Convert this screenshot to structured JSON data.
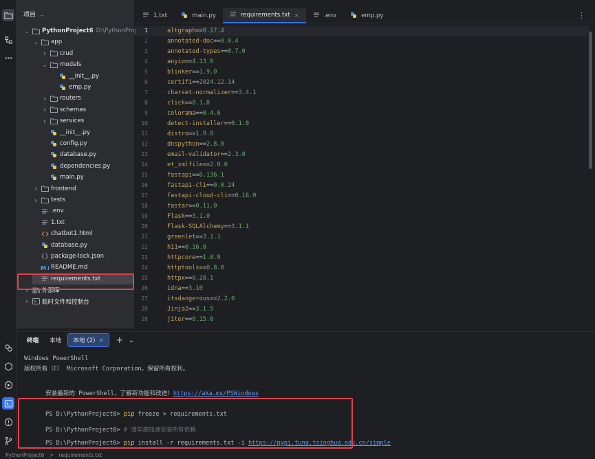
{
  "project": {
    "header": "项目",
    "tree": [
      {
        "label": "PythonProject6",
        "dim": "D:\\PythonProjec",
        "icon": "folder",
        "chev": "open",
        "level": 0,
        "bold": true
      },
      {
        "label": "app",
        "icon": "folder",
        "chev": "open",
        "level": 1
      },
      {
        "label": "crud",
        "icon": "folder",
        "chev": "closed",
        "level": 2
      },
      {
        "label": "models",
        "icon": "folder",
        "chev": "open",
        "level": 2
      },
      {
        "label": "__init__.py",
        "icon": "python",
        "chev": "none",
        "level": 3
      },
      {
        "label": "emp.py",
        "icon": "python",
        "chev": "none",
        "level": 3
      },
      {
        "label": "routers",
        "icon": "folder",
        "chev": "closed",
        "level": 2
      },
      {
        "label": "schemas",
        "icon": "folder",
        "chev": "closed",
        "level": 2
      },
      {
        "label": "services",
        "icon": "folder",
        "chev": "closed",
        "level": 2
      },
      {
        "label": "__init__.py",
        "icon": "python",
        "chev": "none",
        "level": 2
      },
      {
        "label": "config.py",
        "icon": "python",
        "chev": "none",
        "level": 2
      },
      {
        "label": "database.py",
        "icon": "python",
        "chev": "none",
        "level": 2
      },
      {
        "label": "dependencies.py",
        "icon": "python",
        "chev": "none",
        "level": 2
      },
      {
        "label": "main.py",
        "icon": "python",
        "chev": "none",
        "level": 2
      },
      {
        "label": "frontend",
        "icon": "folder",
        "chev": "closed",
        "level": 1
      },
      {
        "label": "tests",
        "icon": "folder",
        "chev": "closed",
        "level": 1
      },
      {
        "label": ".env",
        "icon": "text",
        "chev": "none",
        "level": 1
      },
      {
        "label": "1.txt",
        "icon": "text",
        "chev": "none",
        "level": 1
      },
      {
        "label": "chatbot1.html",
        "icon": "html",
        "chev": "none",
        "level": 1
      },
      {
        "label": "database.py",
        "icon": "python",
        "chev": "none",
        "level": 1
      },
      {
        "label": "package-lock.json",
        "icon": "json",
        "chev": "none",
        "level": 1
      },
      {
        "label": "README.md",
        "icon": "md",
        "chev": "none",
        "level": 1
      },
      {
        "label": "requirements.txt",
        "icon": "text",
        "chev": "none",
        "level": 1,
        "selected": true
      },
      {
        "label": "外部库",
        "icon": "library",
        "chev": "closed",
        "level": 0
      },
      {
        "label": "临时文件和控制台",
        "icon": "scratch",
        "chev": "closed",
        "level": 0
      }
    ]
  },
  "tabs": [
    {
      "label": "1.txt",
      "icon": "text"
    },
    {
      "label": "main.py",
      "icon": "python"
    },
    {
      "label": "requirements.txt",
      "icon": "text",
      "active": true,
      "close": "×"
    },
    {
      "label": ".env",
      "icon": "text"
    },
    {
      "label": "emp.py",
      "icon": "python"
    }
  ],
  "kebab": "⋮",
  "requirements": [
    [
      "altgraph",
      "0.17.4"
    ],
    [
      "annotated-doc",
      "0.0.4"
    ],
    [
      "annotated-types",
      "0.7.0"
    ],
    [
      "anyio",
      "4.13.0"
    ],
    [
      "blinker",
      "1.9.0"
    ],
    [
      "certifi",
      "2024.12.14"
    ],
    [
      "charset-normalizer",
      "3.4.1"
    ],
    [
      "click",
      "8.1.8"
    ],
    [
      "colorama",
      "0.4.6"
    ],
    [
      "detect-installer",
      "0.1.0"
    ],
    [
      "distro",
      "1.9.0"
    ],
    [
      "dnspython",
      "2.8.0"
    ],
    [
      "email-validator",
      "2.3.0"
    ],
    [
      "et_xmlfile",
      "2.0.0"
    ],
    [
      "fastapi",
      "0.136.1"
    ],
    [
      "fastapi-cli",
      "0.0.24"
    ],
    [
      "fastapi-cloud-cli",
      "0.18.0"
    ],
    [
      "fastar",
      "0.11.0"
    ],
    [
      "Flask",
      "3.1.0"
    ],
    [
      "Flask-SQLAlchemy",
      "3.1.1"
    ],
    [
      "greenlet",
      "3.1.1"
    ],
    [
      "h11",
      "0.16.0"
    ],
    [
      "httpcore",
      "1.0.9"
    ],
    [
      "httptools",
      "0.8.0"
    ],
    [
      "httpx",
      "0.28.1"
    ],
    [
      "idna",
      "3.10"
    ],
    [
      "itsdangerous",
      "2.2.0"
    ],
    [
      "Jinja2",
      "3.1.5"
    ],
    [
      "jiter",
      "0.15.0"
    ]
  ],
  "terminal": {
    "tabs": [
      {
        "label": "终端",
        "bold": true
      },
      {
        "label": "本地"
      },
      {
        "label": "本地 (2)",
        "active": true,
        "close": "×"
      }
    ],
    "add": "+",
    "dropdown": "⌄",
    "header_lines": [
      "Windows PowerShell",
      "版权所有（C） Microsoft Corporation。保留所有权利。"
    ],
    "install_msg": "安装最新的 PowerShell，了解新功能和改进！",
    "install_link": "https://aka.ms/PSWindows",
    "prompt": "PS D:\\PythonProject6>",
    "commands": [
      {
        "cmd": "pip",
        "rest": " freeze > requirements.txt"
      },
      {
        "comment": "# 清华源加速安装所有依赖"
      },
      {
        "cmd": "pip",
        "rest": " install -r requirements.txt -i ",
        "link": "https://pypi.tuna.tsinghua.edu.cn/simple"
      }
    ]
  },
  "status": {
    "crumbs": [
      "PythonProject6",
      "requirements.txt"
    ],
    "sep": ">"
  },
  "colors": {
    "accent": "#3574f0",
    "highlight": "#e0434b",
    "package": "#c7a65d",
    "version": "#6aab73",
    "command": "#e8c46a"
  }
}
